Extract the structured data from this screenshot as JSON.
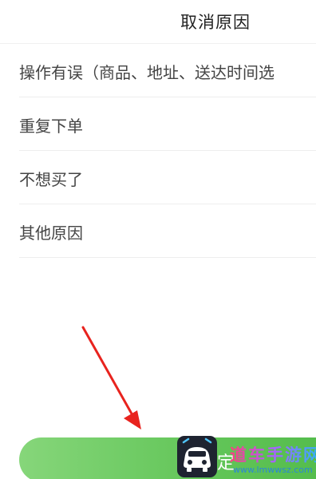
{
  "header": {
    "title": "取消原因"
  },
  "reasons": [
    {
      "label": "操作有误（商品、地址、送达时间选"
    },
    {
      "label": "重复下单"
    },
    {
      "label": "不想买了"
    },
    {
      "label": "其他原因"
    }
  ],
  "footer": {
    "confirm_label": "定"
  },
  "annotation": {
    "arrow_color": "#e8231e",
    "icon": "red-arrow-icon"
  },
  "watermark": {
    "text": "道车手游网",
    "url": "www.lmwwsz.com",
    "logo_icon": "car-logo-icon"
  },
  "colors": {
    "accent_green": "#64c65a",
    "text": "#444444"
  }
}
